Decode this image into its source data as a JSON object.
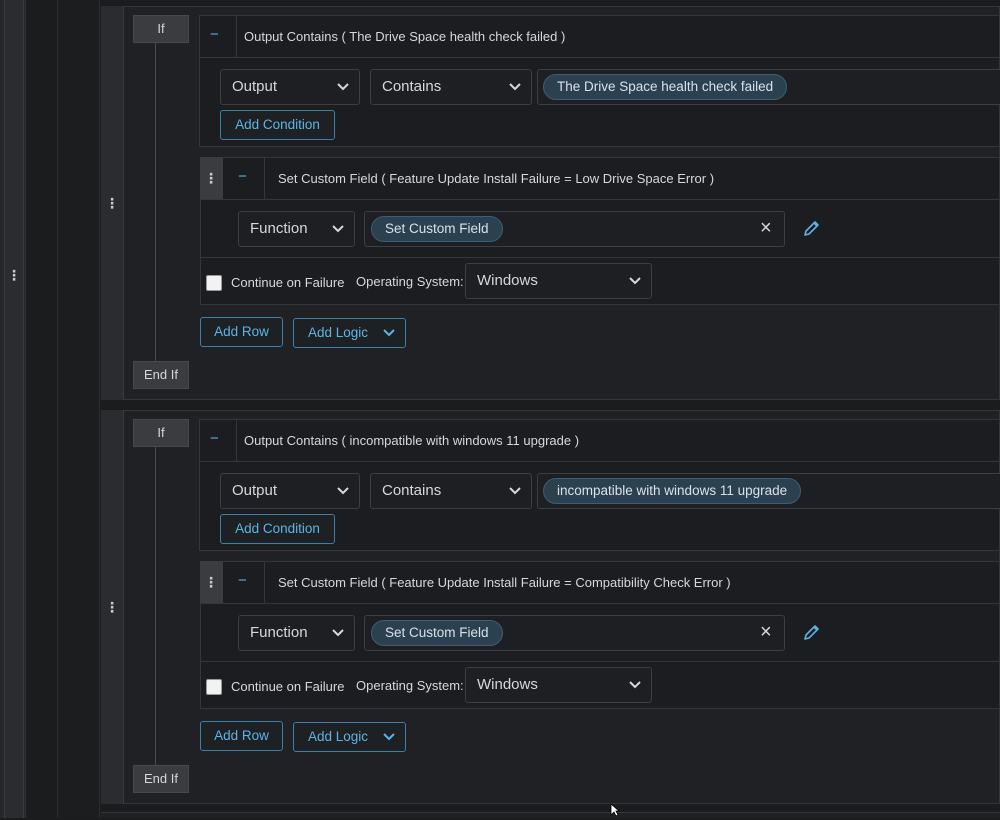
{
  "blocks": [
    {
      "if_label": "If",
      "end_label": "End If",
      "condition_title": "Output Contains ( The Drive Space health check failed )",
      "field_select": "Output",
      "operator_select": "Contains",
      "value_pill": "The Drive Space health check failed",
      "add_condition": "Add Condition",
      "action_title": "Set Custom Field ( Feature Update Install Failure = Low Drive Space Error )",
      "function_select": "Function",
      "function_pill": "Set Custom Field",
      "continue_label": "Continue on Failure",
      "os_label": "Operating System:",
      "os_value": "Windows",
      "add_row": "Add Row",
      "add_logic": "Add Logic"
    },
    {
      "if_label": "If",
      "end_label": "End If",
      "condition_title": "Output Contains ( incompatible with windows 11 upgrade )",
      "field_select": "Output",
      "operator_select": "Contains",
      "value_pill": "incompatible with windows 11 upgrade",
      "add_condition": "Add Condition",
      "action_title": "Set Custom Field ( Feature Update Install Failure = Compatibility Check Error )",
      "function_select": "Function",
      "function_pill": "Set Custom Field",
      "continue_label": "Continue on Failure",
      "os_label": "Operating System:",
      "os_value": "Windows",
      "add_row": "Add Row",
      "add_logic": "Add Logic"
    }
  ],
  "icons": {
    "minus": "−",
    "clear": "×",
    "kebab": "⋮"
  },
  "colors": {
    "accent": "#5fb2e5",
    "background": "#1b1c1e",
    "pill": "#2c4150"
  }
}
